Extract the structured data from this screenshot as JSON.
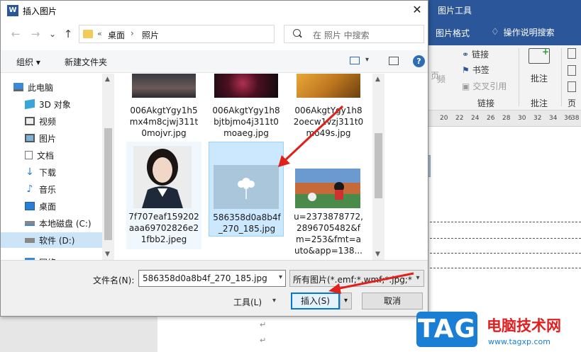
{
  "word": {
    "picture_tools": "图片工具",
    "picture_format": "图片格式",
    "tell_me": "操作说明搜索",
    "ribbon": {
      "link": "链接",
      "bookmark": "书签",
      "cross_ref": "交叉引用",
      "links_group": "链接",
      "comment": "批注",
      "comments_group": "批注",
      "header_cut": "页眉",
      "partial_page": "页",
      "partial_frequency": "频"
    },
    "ruler_ticks": [
      "20",
      "22",
      "24",
      "26",
      "28",
      "30",
      "32",
      "34",
      "36",
      "38"
    ],
    "para_mark": "↵"
  },
  "dialog": {
    "title": "插入图片",
    "close": "✕",
    "nav": {
      "back": "←",
      "forward": "→",
      "recent": "⌄",
      "up": "↑"
    },
    "address": {
      "more": "«",
      "desktop": "桌面",
      "separator": "›",
      "current": "照片",
      "dropdown": "⌄",
      "refresh": "↻"
    },
    "search": {
      "placeholder": "在 照片 中搜索"
    },
    "toolbar": {
      "organize": "组织 ▾",
      "new_folder": "新建文件夹",
      "view_drop": "▾",
      "help": "?"
    },
    "tree": [
      {
        "label": "此电脑",
        "icon": "computer-icon",
        "color": "#3a8ad8"
      },
      {
        "label": "3D 对象",
        "icon": "cube-icon",
        "color": "#39a5dc"
      },
      {
        "label": "视频",
        "icon": "video-icon",
        "color": "#555555"
      },
      {
        "label": "图片",
        "icon": "picture-icon",
        "color": "#555555"
      },
      {
        "label": "文档",
        "icon": "document-icon",
        "color": "#777777"
      },
      {
        "label": "下载",
        "icon": "download-icon",
        "color": "#2a7fd4"
      },
      {
        "label": "音乐",
        "icon": "music-icon",
        "color": "#2a7fd4"
      },
      {
        "label": "桌面",
        "icon": "desktop-icon",
        "color": "#2a7fd4"
      },
      {
        "label": "本地磁盘 (C:)",
        "icon": "drive-icon",
        "color": "#666666"
      },
      {
        "label": "软件 (D:)",
        "icon": "drive-icon",
        "color": "#666666"
      },
      {
        "label": "网络",
        "icon": "network-icon",
        "color": "#3a8ad8"
      }
    ],
    "files": [
      {
        "name": "006AkgtYgy1h5mx4m8cjwj311t0mojvr.jpg",
        "lines": [
          "006AkgtYgy1h5",
          "mx4m8cjwj311t",
          "0mojvr.jpg"
        ]
      },
      {
        "name": "006AkgtYgy1h8bjtbjmo4j311t0moaeg.jpg",
        "lines": [
          "006AkgtYgy1h8",
          "bjtbjmo4j311t0",
          "moaeg.jpg"
        ]
      },
      {
        "name": "006AkgtYgy1h82oecw1vzj311t0mo49s.jpg",
        "lines": [
          "006AkgtYgy1h8",
          "2oecw1vzj311t0",
          "mo49s.jpg"
        ]
      },
      {
        "name": "7f707eaf159202aaa69702826e21fbb2.jpeg",
        "lines": [
          "7f707eaf159202",
          "aaa69702826e2",
          "1fbb2.jpeg"
        ]
      },
      {
        "name": "586358d0a8b4f_270_185.jpg",
        "lines": [
          "586358d0a8b4f",
          "_270_185.jpg"
        ]
      },
      {
        "name": "u=2373878772,2896705482&fm=253&fmt=auto&app=138",
        "lines": [
          "u=2373878772,",
          "2896705482&f",
          "m=253&fmt=a",
          "uto&app=138..."
        ]
      }
    ],
    "bottom": {
      "filename_label": "文件名(N):",
      "filename_value": "586358d0a8b4f_270_185.jpg",
      "filetype_value": "所有图片(*.emf;*.wmf;*.jpg;*.jp",
      "dropdown": "▾",
      "tools": "工具(L)",
      "insert": "插入(S)",
      "cancel": "取消"
    }
  },
  "watermark": {
    "logo_text": "TAG",
    "site_name": "电脑技术网",
    "url": "www.tagxp.com"
  },
  "colors": {
    "word_blue": "#2b579a",
    "selection": "#cce8ff",
    "annotation_red": "#e0201b",
    "watermark_blue": "#1a7fd4"
  }
}
